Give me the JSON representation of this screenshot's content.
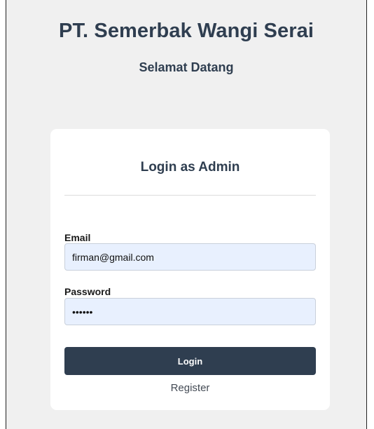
{
  "header": {
    "company_name": "PT. Semerbak Wangi Serai",
    "welcome": "Selamat Datang"
  },
  "login_card": {
    "title": "Login as Admin",
    "email_label": "Email",
    "email_value": "firman@gmail.com",
    "password_label": "Password",
    "password_value": "123456",
    "login_label": "Login",
    "register_label": "Register"
  },
  "colors": {
    "primary": "#2f3e50",
    "page_background": "#f0f0f0",
    "card_background": "#ffffff",
    "autofill_background": "#e8f0fe"
  }
}
